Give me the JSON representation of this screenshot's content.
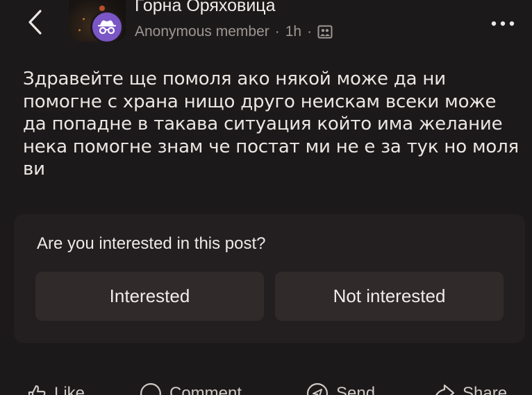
{
  "header": {
    "back_icon": "chevron-left-icon",
    "group_name": "Горна Оряховица",
    "author": "Anonymous member",
    "separator": "·",
    "time": "1h",
    "audience_icon": "group-audience-icon",
    "more_icon": "more-horizontal-icon"
  },
  "post": {
    "text": "Здравейте ще помоля ако някой може да ни помогне с храна нищо друго неискам всеки може да попадне в такава ситуация който има желание нека помогне знам че постат ми не е за тук но моля ви"
  },
  "interest_prompt": {
    "question": "Are you interested in this post?",
    "interested_label": "Interested",
    "not_interested_label": "Not interested"
  },
  "actions": {
    "like": "Like",
    "comment": "Comment",
    "send": "Send",
    "share": "Share"
  },
  "colors": {
    "background": "#1c191a",
    "card": "#231f20",
    "button": "#302a2a",
    "avatar": "#7a56c6",
    "muted_text": "#9d9794"
  }
}
